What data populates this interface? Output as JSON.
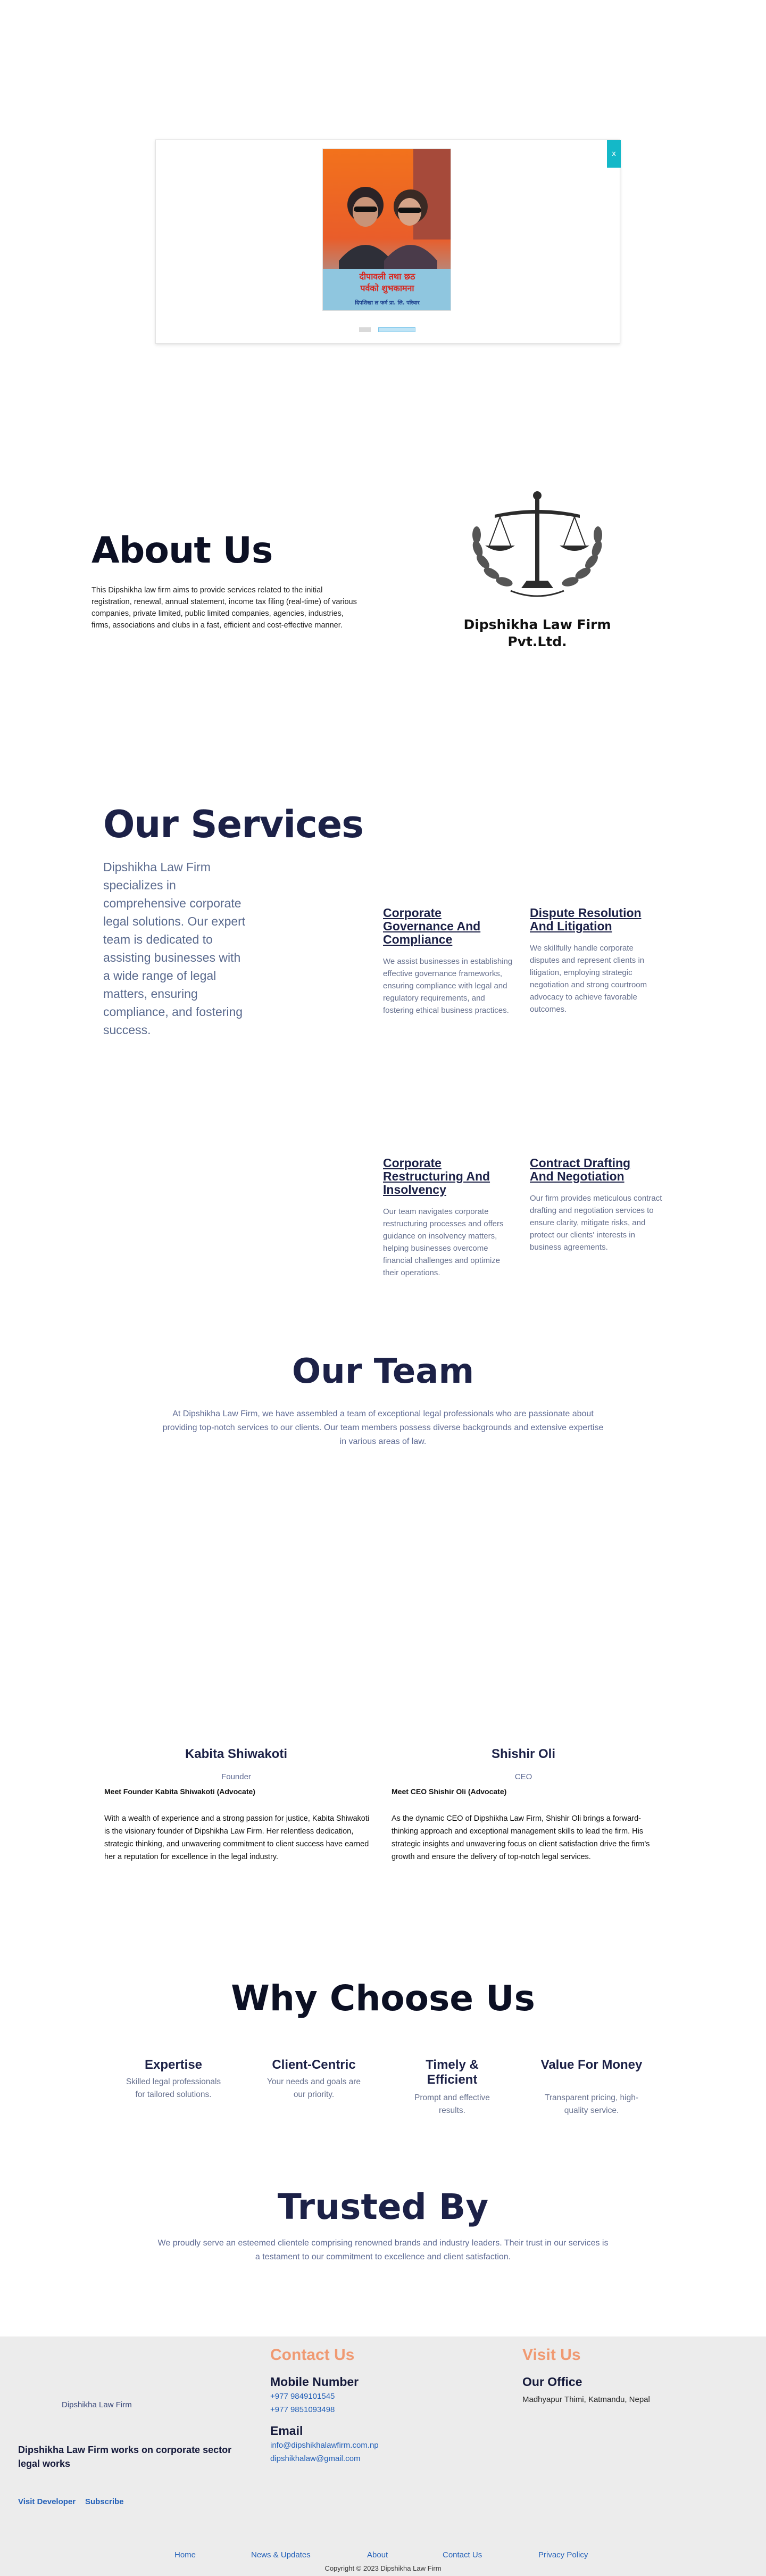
{
  "popup": {
    "close_icon": "x",
    "image_alt": "Photo greeting card with two people",
    "greeting_line1": "दीपावली तथा छठ",
    "greeting_line2": "पर्वको शुभकामना",
    "greeting_line3": "दिपशिखा ल फर्म प्रा. लि. परिवार"
  },
  "about": {
    "heading": "About Us",
    "text": "This Dipshikha law firm aims to provide services related to the initial registration, renewal, annual statement, income tax filing (real-time) of various companies, private limited, public limited companies, agencies, industries, firms, associations and clubs in a fast, efficient and cost-effective manner.",
    "logo_caption": "Dipshikha Law Firm Pvt.Ltd."
  },
  "services": {
    "heading": "Our Services",
    "intro": "Dipshikha Law Firm specializes in comprehensive corporate legal solutions. Our expert team is dedicated to assisting businesses with a wide range of legal matters, ensuring compliance, and fostering success.",
    "items": [
      {
        "title": "Corporate Governance And Compliance",
        "text": "We assist businesses in establishing effective governance frameworks, ensuring compliance with legal and regulatory requirements, and fostering ethical business practices."
      },
      {
        "title": "Dispute Resolution And Litigation",
        "text": "We skillfully handle corporate disputes and represent clients in litigation, employing strategic negotiation and strong courtroom advocacy to achieve favorable outcomes."
      },
      {
        "title": "Corporate Restructuring And Insolvency",
        "text": "Our team navigates corporate restructuring processes and offers guidance on insolvency matters, helping businesses overcome financial challenges and optimize their operations."
      },
      {
        "title": "Contract Drafting And Negotiation",
        "text": "Our firm provides meticulous contract drafting and negotiation services to ensure clarity, mitigate risks, and protect our clients' interests in business agreements."
      }
    ]
  },
  "team": {
    "heading": "Our Team",
    "intro": "At Dipshikha Law Firm, we have assembled a team of exceptional legal professionals who are passionate about providing top-notch services to our clients. Our team members possess diverse backgrounds and extensive expertise in various areas of law.",
    "members": [
      {
        "name": "Kabita Shiwakoti",
        "role": "Founder",
        "meet": "Meet Founder Kabita Shiwakoti (Advocate)",
        "bio": "With a wealth of experience and a strong passion for justice, Kabita Shiwakoti is the visionary founder of Dipshikha Law Firm. Her relentless dedication, strategic thinking, and unwavering commitment to client success have earned her a reputation for excellence in the legal industry."
      },
      {
        "name": "Shishir Oli",
        "role": "CEO",
        "meet": "Meet CEO Shishir Oli (Advocate)",
        "bio": "As the dynamic CEO of Dipshikha Law Firm, Shishir Oli brings a forward-thinking approach and exceptional management skills to lead the firm. His strategic insights and unwavering focus on client satisfaction drive the firm's growth and ensure the delivery of top-notch legal services."
      }
    ]
  },
  "why": {
    "heading": "Why Choose Us",
    "items": [
      {
        "title": "Expertise",
        "text": "Skilled legal professionals for tailored solutions."
      },
      {
        "title": "Client-Centric",
        "text": "Your needs and goals are our priority."
      },
      {
        "title": "Timely & Efficient",
        "text": "Prompt and effective results."
      },
      {
        "title": "Value For Money",
        "text": "Transparent pricing, high-quality service."
      }
    ]
  },
  "trusted": {
    "heading": "Trusted By",
    "text": "We proudly serve an esteemed clientele comprising renowned brands and industry leaders. Their trust in our services is a testament to our commitment to excellence and client satisfaction."
  },
  "footer": {
    "firm_name": "Dipshikha Law Firm",
    "tagline": "Dipshikha Law Firm works on corporate sector legal works",
    "visit_developer": "Visit Developer",
    "subscribe": "Subscribe",
    "contact_heading": "Contact Us",
    "mobile_heading": "Mobile Number",
    "phone1": "+977 9849101545",
    "phone2": "+977 9851093498",
    "email_heading": "Email",
    "email1": "info@dipshikhalawfirm.com.np",
    "email2": "dipshikhalaw@gmail.com",
    "visit_heading": "Visit Us",
    "office_heading": "Our Office",
    "address": "Madhyapur Thimi, Katmandu, Nepal",
    "nav": [
      "Home",
      "News & Updates",
      "About",
      "Contact Us",
      "Privacy Policy"
    ],
    "copyright": "Copyright © 2023 Dipshikha Law Firm"
  },
  "colors": {
    "navy": "#1c2147",
    "muted_blue": "#5f6b94",
    "accent_teal": "#14b8c8",
    "accent_orange": "#f09a72",
    "link_blue": "#2360b8",
    "footer_bg": "#ececec"
  }
}
